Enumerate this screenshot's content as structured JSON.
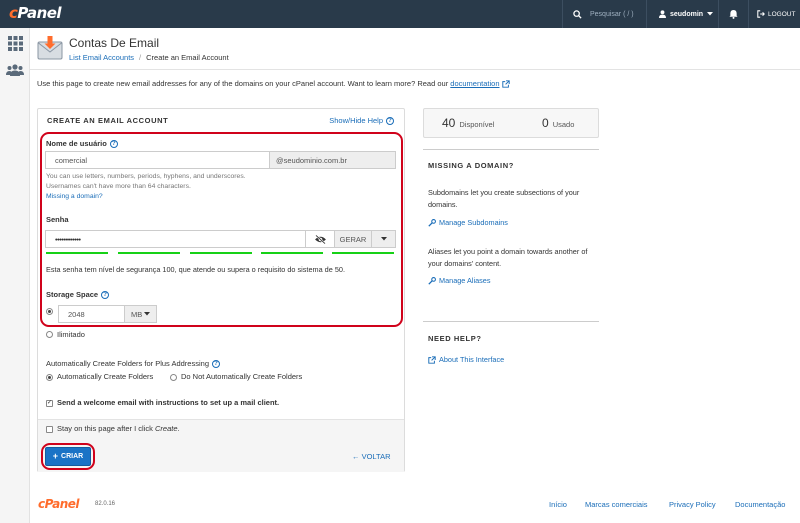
{
  "topbar": {
    "logo": "cPanel",
    "search_placeholder": "Pesquisar ( / )",
    "username": "seudomin",
    "logout_label": "LOGOUT"
  },
  "header": {
    "title": "Contas De Email",
    "breadcrumb_link": "List Email Accounts",
    "breadcrumb_current": "Create an Email Account",
    "intro_text": "Use this page to create new email addresses for any of the domains on your cPanel account. Want to learn more? Read our",
    "intro_link": "documentation"
  },
  "form": {
    "section_title": "CREATE AN EMAIL ACCOUNT",
    "toggle_help": "Show/Hide Help",
    "username_label": "Nome de usuário",
    "username_value": "comercial",
    "domain_addon": "@seudominio.com.br",
    "username_hint_1": "You can use letters, numbers, periods, hyphens, and underscores.",
    "username_hint_2": "Usernames can't have more than 64 characters.",
    "missing_domain_link": "Missing a domain?",
    "password_label": "Senha",
    "password_value": "••••••••••••",
    "generate_label": "GERAR",
    "strength_text": "Esta senha tem nível de segurança 100, que atende ou supera o requisito do sistema de 50.",
    "strength_score": 100,
    "storage_label": "Storage Space",
    "storage_value": "2048",
    "storage_unit": "MB",
    "unlimited_label": "Ilimitado",
    "plus_label": "Automatically Create Folders for Plus Addressing",
    "plus_option_auto": "Automatically Create Folders",
    "plus_option_manual": "Do Not Automatically Create Folders",
    "welcome_label": "Send a welcome email with instructions to set up a mail client.",
    "stay_label_prefix": "Stay on this page after I click",
    "stay_label_em": "Create",
    "stay_label_suffix": ".",
    "create_label": "CRIAR",
    "back_label": "VOLTAR"
  },
  "sidebar": {
    "available_count": "40",
    "available_label": "Disponível",
    "used_count": "0",
    "used_label": "Usado",
    "missing_title": "MISSING A DOMAIN?",
    "missing_p1": "Subdomains let you create subsections of your domains.",
    "manage_subdomains": "Manage Subdomains",
    "missing_p2": "Aliases let you point a domain towards another of your domains' content.",
    "manage_aliases": "Manage Aliases",
    "help_title": "NEED HELP?",
    "about_link": "About This Interface"
  },
  "footer": {
    "logo": "cPanel",
    "version": "82.0.16",
    "links": [
      "Início",
      "Marcas comerciais",
      "Privacy Policy",
      "Documentação"
    ]
  },
  "colors": {
    "topbar": "#293a4a",
    "brand_orange": "#ff6c2c",
    "link": "#1a6db8",
    "highlight_red": "#d0021b",
    "strength_green": "#16d116",
    "primary_button": "#1a73c6"
  }
}
